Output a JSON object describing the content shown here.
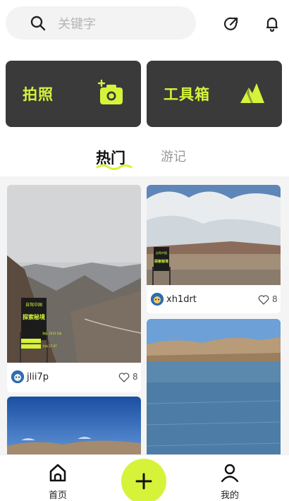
{
  "search": {
    "placeholder": "关键字"
  },
  "actions": [
    {
      "label": "拍照"
    },
    {
      "label": "工具箱"
    }
  ],
  "tabs": [
    {
      "label": "热门",
      "active": true
    },
    {
      "label": "游记",
      "active": false
    }
  ],
  "posts": [
    {
      "username": "jlii7p",
      "likes": "8",
      "sign_text_top": "自驾中国",
      "sign_text_main": "探索秘境",
      "sign_text_small1": "海拔 2231.5米",
      "sign_text_small2": "方向 27.07"
    },
    {
      "username": "xh1drt",
      "likes": "8",
      "sign_text_top": "自驾中国",
      "sign_text_main": "探索秘境"
    },
    {
      "username": "",
      "likes": ""
    },
    {
      "username": "",
      "likes": ""
    }
  ],
  "nav": {
    "home": "首页",
    "me": "我的"
  },
  "colors": {
    "accent": "#d6f33a",
    "card_bg": "#3a3a3a"
  }
}
